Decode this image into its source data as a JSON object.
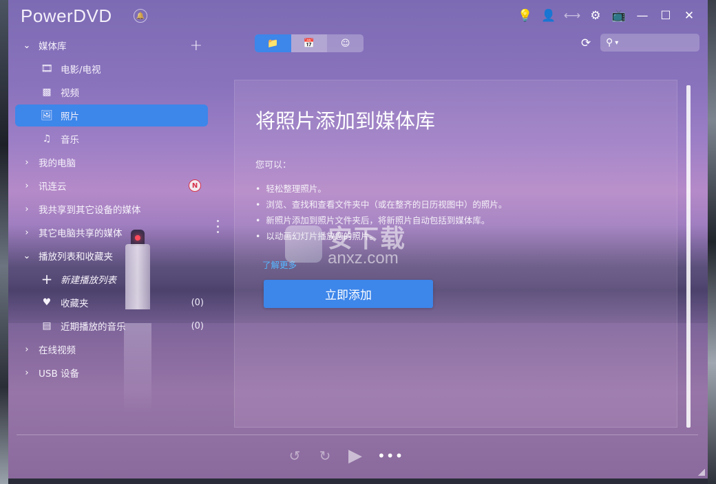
{
  "app": {
    "title": "PowerDVD"
  },
  "titlebar": {
    "icons": [
      "bulb-icon",
      "user-icon",
      "share-icon",
      "gear-icon",
      "tv-icon",
      "minimize-icon",
      "maximize-icon",
      "close-icon"
    ]
  },
  "sidebar": {
    "media_library": "媒体库",
    "movies_tv": "电影/电视",
    "videos": "视频",
    "photos": "照片",
    "music": "音乐",
    "my_computer": "我的电脑",
    "cloud": "讯连云",
    "cloud_badge": "N",
    "share_to_devices": "我共享到其它设备的媒体",
    "shared_by_others": "其它电脑共享的媒体",
    "playlists": "播放列表和收藏夹",
    "new_playlist": "新建播放列表",
    "favorites": "收藏夹",
    "favorites_count": "(0)",
    "recent_music": "近期播放的音乐",
    "recent_music_count": "(0)",
    "online_video": "在线视频",
    "usb": "USB 设备"
  },
  "search": {
    "placeholder": ""
  },
  "content": {
    "title": "将照片添加到媒体库",
    "subtitle": "您可以：",
    "bullets": [
      "轻松整理照片。",
      "浏览、查找和查看文件夹中（或在整齐的日历视图中）的照片。",
      "新照片添加到照片文件夹后，将新照片自动包括到媒体库。",
      "以动画幻灯片播放您的照片。"
    ],
    "learn_more": "了解更多",
    "add_button": "立即添加"
  },
  "watermark": {
    "text": "安下载",
    "sub": "anxz.com"
  },
  "colors": {
    "accent": "#3d86ea",
    "link": "#56b6ff",
    "bulb": "#ffd630"
  }
}
